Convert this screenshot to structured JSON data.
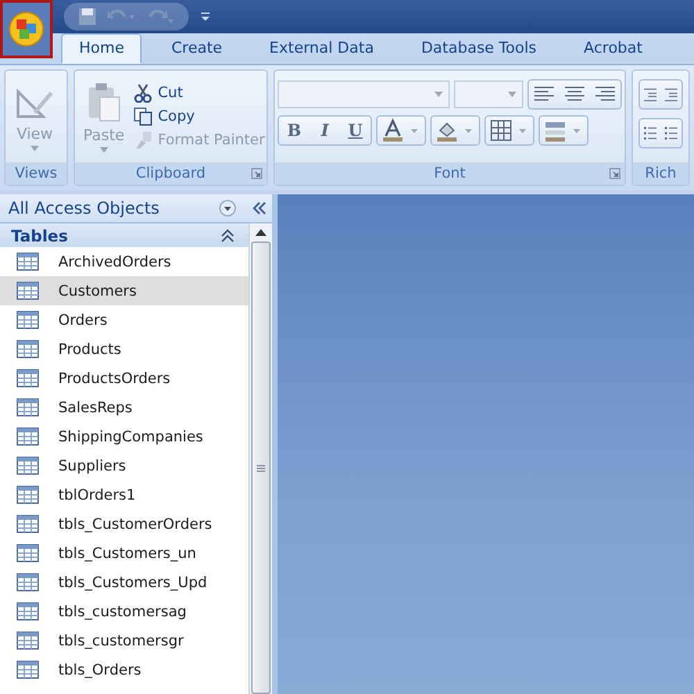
{
  "tabs": [
    {
      "label": "Home",
      "selected": true
    },
    {
      "label": "Create",
      "selected": false
    },
    {
      "label": "External Data",
      "selected": false
    },
    {
      "label": "Database Tools",
      "selected": false
    },
    {
      "label": "Acrobat",
      "selected": false
    }
  ],
  "ribbon": {
    "views": {
      "label": "Views",
      "view_button": "View",
      "disabled": true
    },
    "clipboard": {
      "label": "Clipboard",
      "paste": "Paste",
      "cut": "Cut",
      "copy": "Copy",
      "format_painter": "Format Painter",
      "paste_disabled": true,
      "format_painter_disabled": true
    },
    "font": {
      "label": "Font",
      "bold": "B",
      "italic": "I",
      "underline": "U"
    },
    "rich_text": {
      "label": "Rich"
    }
  },
  "nav_pane": {
    "title": "All Access Objects",
    "section": "Tables",
    "items": [
      {
        "label": "ArchivedOrders",
        "selected": false
      },
      {
        "label": "Customers",
        "selected": true
      },
      {
        "label": "Orders",
        "selected": false
      },
      {
        "label": "Products",
        "selected": false
      },
      {
        "label": "ProductsOrders",
        "selected": false
      },
      {
        "label": "SalesReps",
        "selected": false
      },
      {
        "label": "ShippingCompanies",
        "selected": false
      },
      {
        "label": "Suppliers",
        "selected": false
      },
      {
        "label": "tblOrders1",
        "selected": false
      },
      {
        "label": "tbls_CustomerOrders",
        "selected": false
      },
      {
        "label": "tbls_Customers_un",
        "selected": false
      },
      {
        "label": "tbls_Customers_Upd",
        "selected": false
      },
      {
        "label": "tbls_customersag",
        "selected": false
      },
      {
        "label": "tbls_customersgr",
        "selected": false
      },
      {
        "label": "tbls_Orders",
        "selected": false
      }
    ]
  }
}
